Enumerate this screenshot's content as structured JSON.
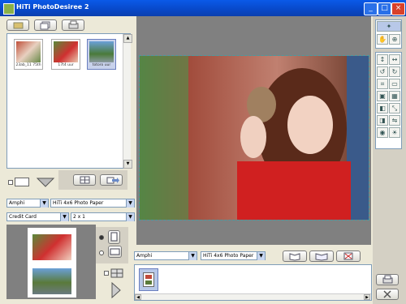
{
  "window": {
    "title": "HiTi PhotoDesiree 2",
    "minimize": "_",
    "maximize": "□",
    "close": "×"
  },
  "left_toolbar": {
    "folder_icon": "folder-icon",
    "stack_icon": "stack-icon",
    "print_icon": "print-icon"
  },
  "thumbnails": [
    {
      "caption": "23ab_11 75th",
      "selected": false
    },
    {
      "caption": "17t4 uur",
      "selected": false
    },
    {
      "caption": "totoro uur",
      "selected": true
    }
  ],
  "paper_settings": {
    "printer": "Amphi",
    "paper_type": "HiTi 4x6 Photo Paper",
    "size": "Credit Card",
    "layout": "2 x 1"
  },
  "bottom_bar": {
    "printer": "Amphi",
    "paper_type": "HiTi 4x6 Photo Paper"
  },
  "colors": {
    "accent": "#0a5ae8",
    "canvas_bg": "#808080",
    "panel_bg": "#ece9d8"
  }
}
